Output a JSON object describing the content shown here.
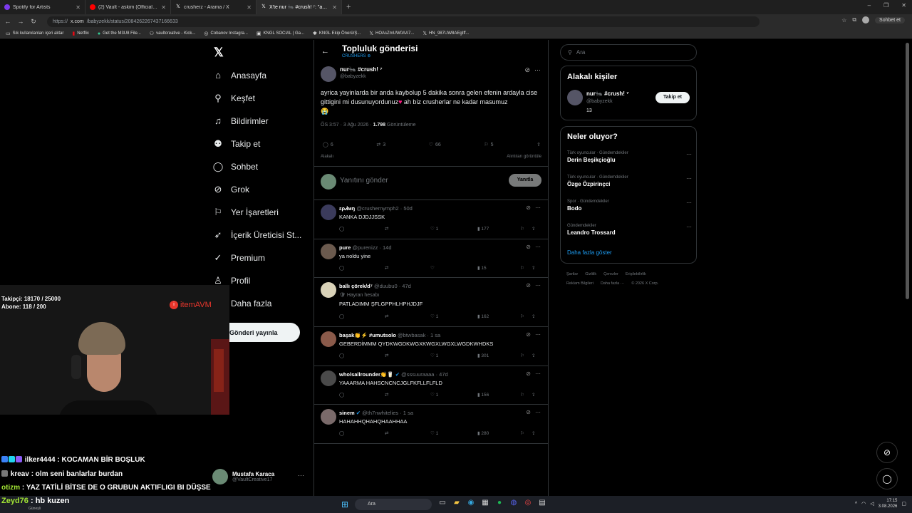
{
  "browser": {
    "tabs": [
      {
        "title": "Spotify for Artists",
        "icon": "spotify-icon",
        "color": "#7c3aed"
      },
      {
        "title": "(2) Vault - askim (Official Music Vi",
        "icon": "youtube-icon",
        "color": "#ff0000"
      },
      {
        "title": "crusherz - Arama / X",
        "icon": "x-icon",
        "color": "#ffffff"
      },
      {
        "title": "X'te nur 🐜 #crush! ⁷: \"ayrica yayin",
        "icon": "x-icon",
        "color": "#ffffff"
      }
    ],
    "url_prefix": "https://",
    "url_host": "x.com",
    "url_path": "/babyzekk/status/2084262267437166633",
    "profile_label": "Sohbet et",
    "bookmarks": [
      "Sık kullanılanları içeri aktar",
      "Netflix",
      "Get the M3U8 File...",
      "vaultcreative - Kick...",
      "Cobanov Instagra...",
      "KNGL SOCIAL | Ga...",
      "KNGL Ekip Önerü/Ş...",
      "HOAsZmUW0AA7...",
      "HN_987UW8AEgIff..."
    ]
  },
  "nav": {
    "items": [
      {
        "label": "Anasayfa",
        "icon": "home-icon",
        "glyph": "⌂"
      },
      {
        "label": "Keşfet",
        "icon": "search-icon",
        "glyph": "⚲"
      },
      {
        "label": "Bildirimler",
        "icon": "bell-icon",
        "glyph": "🔔"
      },
      {
        "label": "Takip et",
        "icon": "follow-icon",
        "glyph": "👤"
      },
      {
        "label": "Sohbet",
        "icon": "chat-icon",
        "glyph": "💬"
      },
      {
        "label": "Grok",
        "icon": "grok-icon",
        "glyph": "⊘"
      },
      {
        "label": "Yer İşaretleri",
        "icon": "bookmark-icon",
        "glyph": "🔖"
      },
      {
        "label": "İçerik Üreticisi St...",
        "icon": "rocket-icon",
        "glyph": "➶"
      },
      {
        "label": "Premium",
        "icon": "verified-icon",
        "glyph": "✓"
      },
      {
        "label": "Profil",
        "icon": "profile-icon",
        "glyph": "👤"
      },
      {
        "label": "Daha fazla",
        "icon": "more-icon",
        "glyph": "⋯"
      }
    ],
    "post_button": "Gönderi yayınla",
    "account_name": "Mustafa Karaca",
    "account_handle": "@VaultCreative17"
  },
  "main": {
    "title": "Topluluk gönderisi",
    "community": "CRUSHERS ⊕",
    "author_name": "nur🐜 #crush! ⁷",
    "author_handle": "@babyzekk",
    "text_1": "ayrica yayinlarda bir anda kaybolup 5 dakika sonra gelen efenin ardayla cise gittigini mi dusunuyordunuz",
    "text_2": " ah biz crusherlar ne kadar masumuz",
    "emoji_end": "😭",
    "meta_time": "ÖS 3:57 · 3 Ağu 2026 · ",
    "meta_views": "1.798",
    "meta_views_label": " Görüntüleme",
    "stats": {
      "replies": "6",
      "reposts": "3",
      "likes": "66",
      "bookmarks": "5"
    },
    "sort_label": "Alakalı",
    "quotes_label": "Alıntıları görüntüle",
    "reply_placeholder": "Yanıtını gönder",
    "reply_button": "Yanıtla",
    "replies": [
      {
        "name": "ερᏗмŋ",
        "handle": "@crushernymph2 · 50d",
        "badge": "",
        "text": "KANKA DJDJJSSK",
        "likes": "1",
        "views": "177",
        "avatar": "#3b3b5c"
      },
      {
        "name": "pure",
        "handle": "@purenizz · 14d",
        "badge": "",
        "text": "ya noldu yine",
        "likes": "",
        "views": "15",
        "avatar": "#6b5a4e"
      },
      {
        "name": "ballı çörek/d⁷",
        "handle": "@duubu0 · 47d",
        "badge": "🛡 Hayran hesabı",
        "text": "PATLADIMM ŞFLGPPHLHPHJDJF",
        "likes": "1",
        "views": "162",
        "avatar": "#d9d2b8"
      },
      {
        "name": "başak👏⚡ #umutsolo",
        "handle": "@btwbasak · 1 sa",
        "badge": "",
        "text": "GEBERDİMMM QYDKWGDKWGXKWGXLWGXLWGDKWHDKS",
        "likes": "1",
        "views": "301",
        "avatar": "#8a5a4a"
      },
      {
        "name": "wholsallrounder👏🥛",
        "handle": "@sssuuraaaa · 47d",
        "badge": "",
        "text": "YAAARMA HAHSCNCNCJGLFKFLLFLFLD",
        "likes": "1",
        "views": "156",
        "avatar": "#4a4a4a",
        "verified": "✔"
      },
      {
        "name": "sinem",
        "handle": "@th7nwhitelies · 1 sa",
        "badge": "",
        "text": "HAHAHHQHAHQHAAHHAA",
        "likes": "1",
        "views": "280",
        "avatar": "#7a6a6a",
        "verified": "✔"
      }
    ]
  },
  "right": {
    "search_placeholder": "Ara",
    "related_title": "Alakalı kişiler",
    "related_name": "nur🐜 #crush! ⁷",
    "related_handle": "@babyzekk",
    "related_count": "13",
    "follow_label": "Takip et",
    "trends_title": "Neler oluyor?",
    "trends": [
      {
        "category": "Türk oyuncular · Gündemdekiler",
        "name": "Derin Beşikçioğlu"
      },
      {
        "category": "Türk oyuncular · Gündemdekiler",
        "name": "Özge Özpirinçci"
      },
      {
        "category": "Spor · Gündemdekiler",
        "name": "Bodo"
      },
      {
        "category": "Gündemdekiler",
        "name": "Leandro Trossard"
      }
    ],
    "show_more": "Daha fazla göster",
    "footer_1": [
      "Şartlar",
      "Gizlilik",
      "Çerezler",
      "Erişilebilirlik"
    ],
    "footer_2": [
      "Reklam Bilgileri",
      "Daha fazla ···",
      "© 2026 X Corp."
    ]
  },
  "stream": {
    "followers": "Takipçi: 18170 / 25000",
    "subs": "Abone: 118 / 200",
    "brand": "itemAVM",
    "chat": [
      {
        "user": "ilker4444",
        "msg": " : KOCAMAN BİR BOŞLUK",
        "color": "#ffffff"
      },
      {
        "user": "kreav",
        "msg": " : olm seni banlarlar burdan",
        "color": "#ffffff"
      },
      {
        "user": "otizm",
        "msg": " : YAZ TATİLİ BİTSE DE O GRUBUN AKTIFLIGI BI DÜŞSE",
        "color": "#a3e635"
      },
      {
        "user": "Zeyd76",
        "msg": " : hb kuzen",
        "color": "#a3e635"
      }
    ]
  },
  "taskbar": {
    "weather": "Güneşli",
    "search": "Ara",
    "time": "17:15",
    "date": "3.08.2026"
  }
}
